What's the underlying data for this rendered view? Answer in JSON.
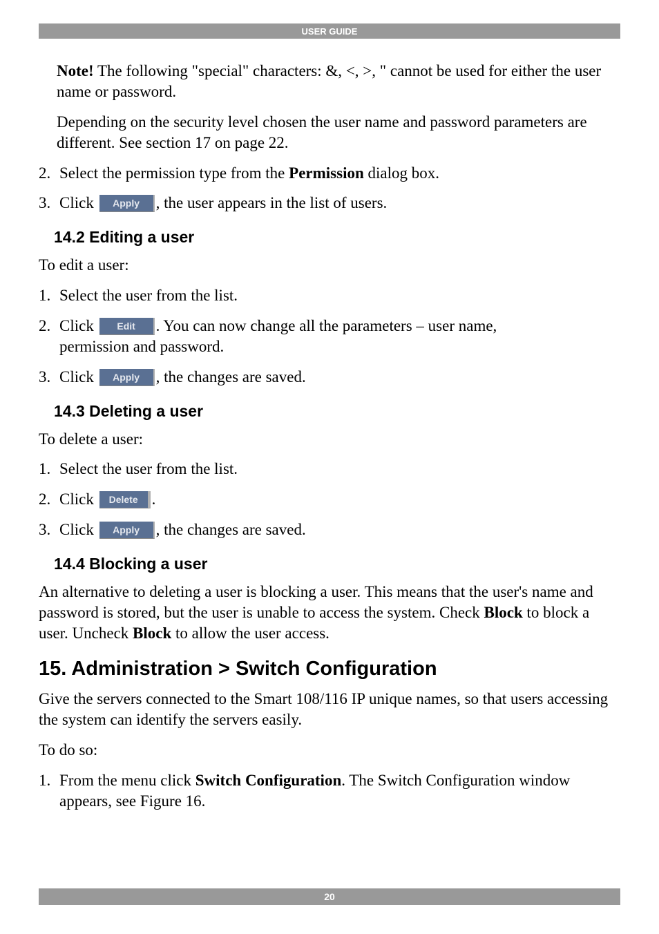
{
  "header": {
    "title": "USER GUIDE"
  },
  "footer": {
    "page_number": "20"
  },
  "note_block": {
    "note_label": "Note!",
    "note_rest": " The following \"special\" characters: &, <, >, \" cannot be used for either the user name or password.",
    "depending": "Depending on the security level chosen the user name and password parameters are different. See section 17 on page 22."
  },
  "top_steps": {
    "step2": {
      "num": "2.",
      "pre": "Select the permission type from the ",
      "bold": "Permission",
      "post": " dialog box."
    },
    "step3": {
      "num": "3.",
      "pre": "Click ",
      "btn": "Apply",
      "post": ", the user appears in the list of users."
    }
  },
  "s142": {
    "heading": "14.2 Editing a user",
    "intro": "To edit a user:",
    "step1": {
      "num": "1.",
      "text": "Select the user from the list."
    },
    "step2": {
      "num": "2.",
      "pre": "Click ",
      "btn": "Edit",
      "post1": ". You can now change all the parameters – user name,",
      "post2": "permission and password."
    },
    "step3": {
      "num": "3.",
      "pre": "Click ",
      "btn": "Apply",
      "post": ", the changes are saved."
    }
  },
  "s143": {
    "heading": "14.3 Deleting a user",
    "intro": "To delete a user:",
    "step1": {
      "num": "1.",
      "text": "Select the user from the list."
    },
    "step2": {
      "num": "2.",
      "pre": "Click ",
      "btn": "Delete",
      "post": "."
    },
    "step3": {
      "num": "3.",
      "pre": "Click ",
      "btn": "Apply",
      "post": ", the changes are saved."
    }
  },
  "s144": {
    "heading": "14.4 Blocking a user",
    "para_a": "An alternative to deleting a user is blocking a user. This means that the user's name and password is stored, but the user is unable to access the system. Check ",
    "bold_a": "Block",
    "para_b": " to block a user. Uncheck ",
    "bold_b": "Block",
    "para_c": " to allow the user access."
  },
  "s15": {
    "heading": "15. Administration > Switch Configuration",
    "intro": "Give the servers connected to the Smart 108/116 IP unique names, so that users accessing the system can identify the servers easily.",
    "todo": "To do so:",
    "step1": {
      "num": "1.",
      "pre": "From the menu click ",
      "bold": "Switch Configuration",
      "post1": ". The Switch Configuration window",
      "post2": "appears, see Figure 16."
    }
  }
}
